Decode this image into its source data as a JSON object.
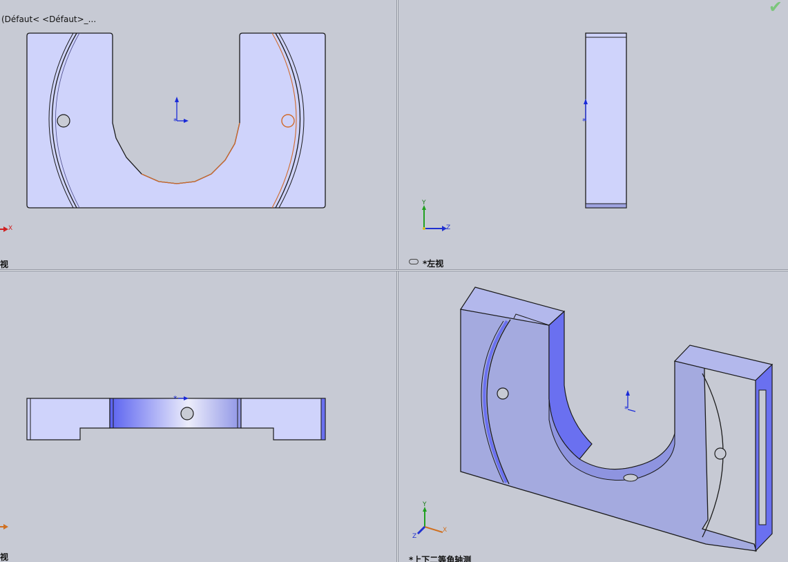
{
  "toolbar": {
    "icons": [
      "zoom-fit-icon",
      "zoom-area-icon",
      "previous-view-icon",
      "section-view-icon",
      "view-orientation-icon",
      "display-style-icon",
      "hide-show-icon",
      "edit-appearance-icon",
      "apply-scene-icon",
      "view-settings-icon"
    ]
  },
  "confirm": {
    "icon": "checkmark-icon",
    "color": "#7bc67b"
  },
  "front_view": {
    "config": "(Défaut< <Défaut>_...",
    "label": "视",
    "triad": {
      "x_label": "X"
    }
  },
  "left_view": {
    "label": "*左视",
    "triad": {
      "y_label": "Y",
      "z_label": "Z"
    }
  },
  "top_view": {
    "label": "视"
  },
  "iso_view": {
    "label": "*上下二等角轴测",
    "triad": {
      "y_label": "Y",
      "x_label": "X",
      "z_label": "Z"
    }
  },
  "colors": {
    "background": "#c7cad4",
    "part_face": "#cfd3fb",
    "part_face_iso": "#a4aadf",
    "part_face_dark": "#6a70f0",
    "edge": "#1a1a1a",
    "selected_edge": "#d06a2a",
    "origin": "#1a2ad8",
    "axis_x": "#d02020",
    "axis_y": "#20a020",
    "axis_z": "#2030d0"
  }
}
